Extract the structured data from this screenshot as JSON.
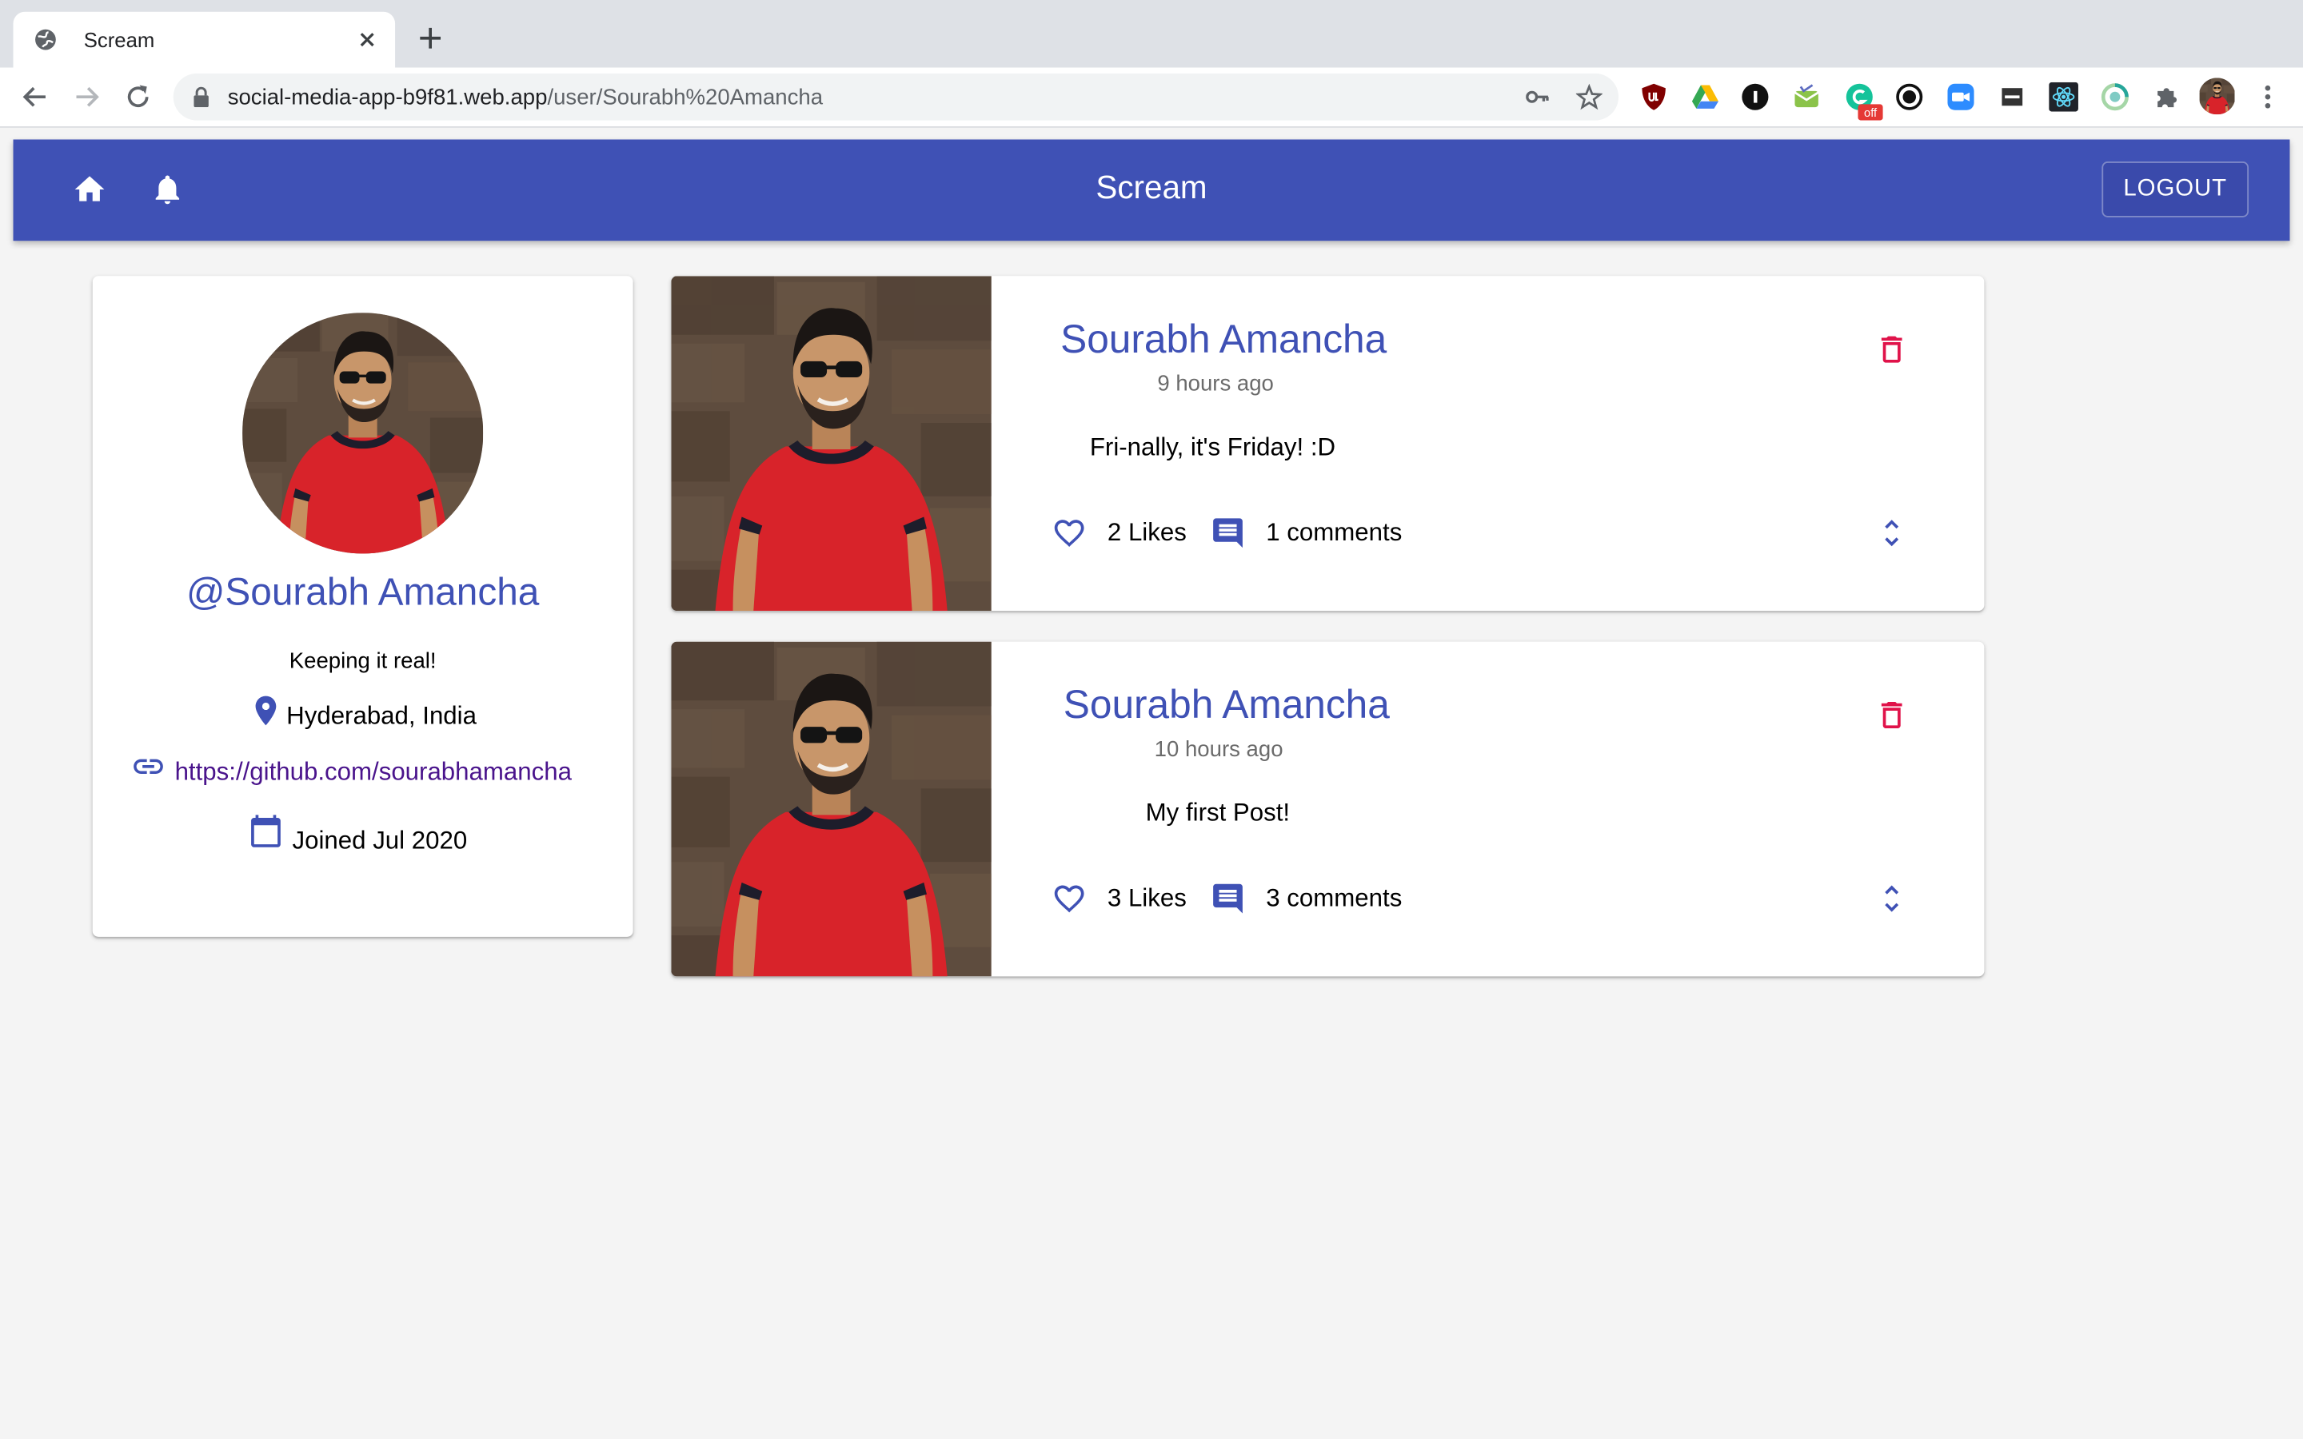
{
  "browser": {
    "tab_title": "Scream",
    "url_host": "social-media-app-b9f81.web.app",
    "url_path": "/user/Sourabh%20Amancha",
    "ext_badge": "off"
  },
  "appbar": {
    "brand": "Scream",
    "logout_label": "LOGOUT"
  },
  "profile": {
    "handle": "@Sourabh Amancha",
    "bio": "Keeping it real!",
    "location": "Hyderabad, India",
    "website": "https://github.com/sourabhamancha",
    "joined": "Joined Jul 2020"
  },
  "posts": [
    {
      "author": "Sourabh Amancha",
      "time": "9 hours ago",
      "body": "Fri-nally, it's Friday! :D",
      "likes": "2 Likes",
      "comments": "1 comments"
    },
    {
      "author": "Sourabh Amancha",
      "time": "10 hours ago",
      "body": "My first Post!",
      "likes": "3 Likes",
      "comments": "3 comments"
    }
  ],
  "colors": {
    "primary": "#3f51b5",
    "delete": "#e0134a",
    "link": "#4a148c",
    "shirt": "#d8232a",
    "wall": "#5b4a3c"
  }
}
